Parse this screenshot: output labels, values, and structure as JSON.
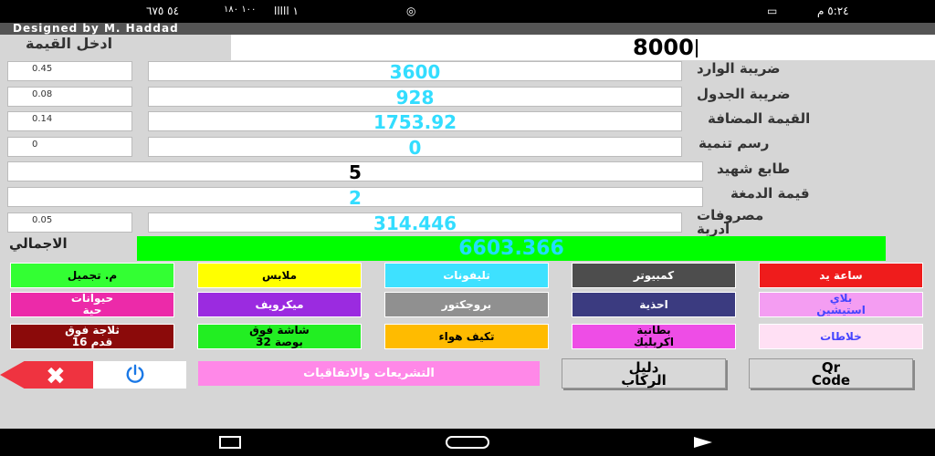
{
  "status_bar": {
    "left_text": "٥٤ ٦٧٥",
    "signal": "١٠٠ ١٨٠",
    "network": "١ ااااا",
    "cast_icon": "cast-icon",
    "battery_icon": "battery-icon",
    "time": "٥:٢٤ م"
  },
  "header": {
    "designer": "Designed by M. Haddad",
    "input_label": "ادخل القيمة",
    "input_value": "8000"
  },
  "rows": [
    {
      "label": "ضريبة الوارد",
      "rate": "0.45",
      "value": "3600"
    },
    {
      "label": "ضريبة الجدول",
      "rate": "0.08",
      "value": "928"
    },
    {
      "label": "القيمة المضافة",
      "rate": "0.14",
      "value": "1753.92"
    },
    {
      "label": "رسم تنمية",
      "rate": "0",
      "value": "0"
    },
    {
      "label": "طابع شهيد",
      "value": "5"
    },
    {
      "label": "قيمة الدمغة",
      "value": "2"
    },
    {
      "label": "مصروفات\nادرية",
      "rate": "0.05",
      "value": "314.446"
    }
  ],
  "total": {
    "label": "الاجمالي",
    "value": "6603.366"
  },
  "categories": [
    {
      "label": "ساعة يد",
      "bg": "#ef1c1c",
      "fg": "#ffffff"
    },
    {
      "label": "كمبيوتر",
      "bg": "#4d4d4d",
      "fg": "#ffffff"
    },
    {
      "label": "تليفونات",
      "bg": "#3ee1ff",
      "fg": "#ffffff"
    },
    {
      "label": "ملابس",
      "bg": "#ffff00",
      "fg": "#000000"
    },
    {
      "label": "م. تجميل",
      "bg": "#33ff33",
      "fg": "#000000"
    },
    {
      "label": "بلاي\nاستيشين",
      "bg": "#f49df2",
      "fg": "#4444ff"
    },
    {
      "label": "احذية",
      "bg": "#3b3b80",
      "fg": "#ffffff"
    },
    {
      "label": "بروجكتور",
      "bg": "#909090",
      "fg": "#ffffff"
    },
    {
      "label": "ميكرويف",
      "bg": "#9b2be0",
      "fg": "#ffffff"
    },
    {
      "label": "حيوانات\nحية",
      "bg": "#ec2aa9",
      "fg": "#ffffff"
    },
    {
      "label": "خلاطات",
      "bg": "#ffe0f4",
      "fg": "#4444ff"
    },
    {
      "label": "بطانية\nاكريليك",
      "bg": "#ee4de6",
      "fg": "#000000"
    },
    {
      "label": "تكيف هواء",
      "bg": "#ffbb00",
      "fg": "#000000"
    },
    {
      "label": "شاشة فوق\n32 بوصة",
      "bg": "#22ee22",
      "fg": "#000000"
    },
    {
      "label": "ثلاجة فوق\n16 قدم",
      "bg": "#8b0a0a",
      "fg": "#ffffff"
    }
  ],
  "bottom": {
    "laws": "التشريعات والاتفاقيات",
    "guide": "دليل\nالركاب",
    "qr": "Qr\nCode",
    "close_icon": "close-icon",
    "power_icon": "power-icon"
  },
  "colors": {
    "background": "#d6d6d6",
    "total_bg": "#00ff00",
    "value_text": "#33ddff",
    "close_bg": "#ef3340",
    "power_blue": "#1a78e6"
  }
}
